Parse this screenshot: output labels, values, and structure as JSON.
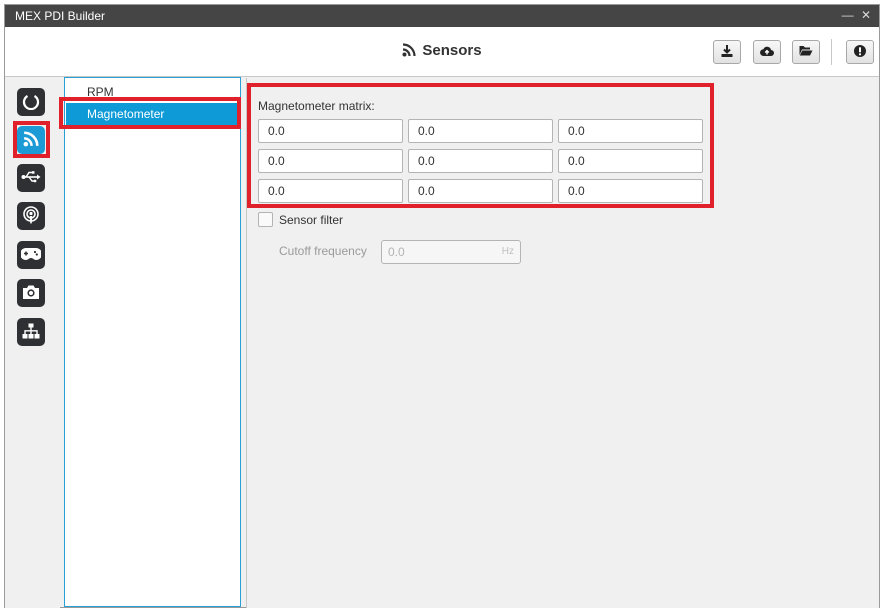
{
  "window": {
    "title": "MEX PDI Builder",
    "controls": "— ✕"
  },
  "header": {
    "title": "Sensors",
    "title_icon": "rss-icon",
    "toolbar": [
      {
        "name": "download-button",
        "icon": "download-icon"
      },
      {
        "name": "cloud-upload-button",
        "icon": "cloud-upload-icon"
      },
      {
        "name": "open-folder-button",
        "icon": "folder-open-icon"
      },
      {
        "name": "info-button",
        "icon": "exclamation-icon"
      }
    ]
  },
  "sidebar": {
    "items": [
      {
        "name": "power",
        "icon": "power-icon",
        "active": false
      },
      {
        "name": "sensors",
        "icon": "rss-icon",
        "active": true
      },
      {
        "name": "usb",
        "icon": "usb-icon",
        "active": false
      },
      {
        "name": "radio",
        "icon": "podcast-icon",
        "active": false
      },
      {
        "name": "gamepad",
        "icon": "gamepad-icon",
        "active": false
      },
      {
        "name": "camera",
        "icon": "camera-icon",
        "active": false
      },
      {
        "name": "network",
        "icon": "sitemap-icon",
        "active": false
      }
    ]
  },
  "list": {
    "items": [
      {
        "label": "RPM",
        "selected": false
      },
      {
        "label": "Magnetometer",
        "selected": true
      }
    ]
  },
  "content": {
    "matrix_label": "Magnetometer matrix:",
    "matrix": [
      [
        "0.0",
        "0.0",
        "0.0"
      ],
      [
        "0.0",
        "0.0",
        "0.0"
      ],
      [
        "0.0",
        "0.0",
        "0.0"
      ]
    ],
    "sensor_filter_label": "Sensor filter",
    "sensor_filter_checked": false,
    "cutoff_label": "Cutoff frequency",
    "cutoff_value": "0.0",
    "cutoff_unit": "Hz"
  },
  "colors": {
    "accent": "#1b9ad6",
    "highlight": "#e0202a",
    "titlebar": "#454545",
    "nav_button": "#2f3033"
  }
}
